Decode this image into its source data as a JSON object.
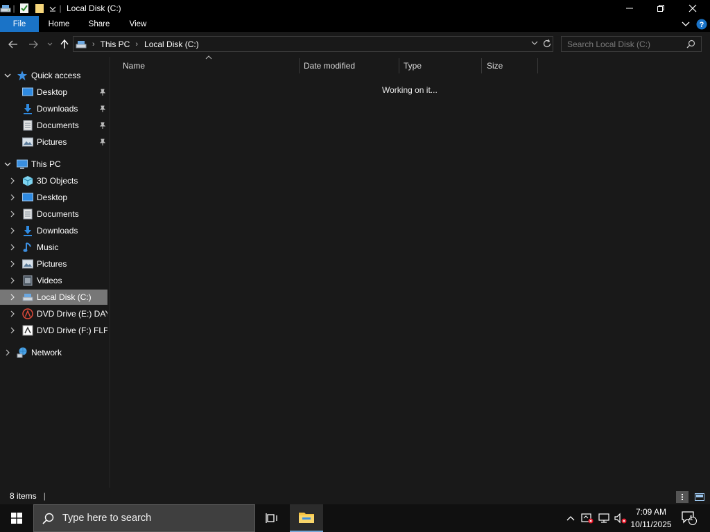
{
  "window": {
    "title": "Local Disk (C:)",
    "controls": {
      "minimize": "minimize-icon",
      "restore": "restore-icon",
      "close": "close-icon"
    }
  },
  "ribbon": {
    "tabs": [
      "File",
      "Home",
      "Share",
      "View"
    ],
    "accent_color": "#1a73c7"
  },
  "address": {
    "crumbs": [
      "This PC",
      "Local Disk (C:)"
    ],
    "search_placeholder": "Search Local Disk (C:)"
  },
  "nav_pane": {
    "quick_access": {
      "label": "Quick access",
      "items": [
        {
          "label": "Desktop",
          "icon": "desktop-icon",
          "pinned": true
        },
        {
          "label": "Downloads",
          "icon": "downloads-icon",
          "pinned": true
        },
        {
          "label": "Documents",
          "icon": "documents-icon",
          "pinned": true
        },
        {
          "label": "Pictures",
          "icon": "pictures-icon",
          "pinned": true
        }
      ]
    },
    "this_pc": {
      "label": "This PC",
      "items": [
        {
          "label": "3D Objects",
          "icon": "3d-objects-icon"
        },
        {
          "label": "Desktop",
          "icon": "desktop-icon"
        },
        {
          "label": "Documents",
          "icon": "documents-icon"
        },
        {
          "label": "Downloads",
          "icon": "downloads-icon"
        },
        {
          "label": "Music",
          "icon": "music-icon"
        },
        {
          "label": "Pictures",
          "icon": "pictures-icon"
        },
        {
          "label": "Videos",
          "icon": "videos-icon"
        },
        {
          "label": "Local Disk (C:)",
          "icon": "local-disk-icon",
          "selected": true
        },
        {
          "label": "DVD Drive (E:) DAY_",
          "icon": "dvd-drive-icon"
        },
        {
          "label": "DVD Drive (F:) FLPR",
          "icon": "dvd-drive-icon"
        }
      ]
    },
    "network": {
      "label": "Network",
      "icon": "network-icon"
    }
  },
  "content": {
    "columns": [
      "Name",
      "Date modified",
      "Type",
      "Size"
    ],
    "status_message": "Working on it..."
  },
  "statusbar": {
    "item_count": "8 items"
  },
  "taskbar": {
    "search_placeholder": "Type here to search",
    "time": "7:09 AM",
    "date": "10/11/2025",
    "notification_count": "1"
  }
}
